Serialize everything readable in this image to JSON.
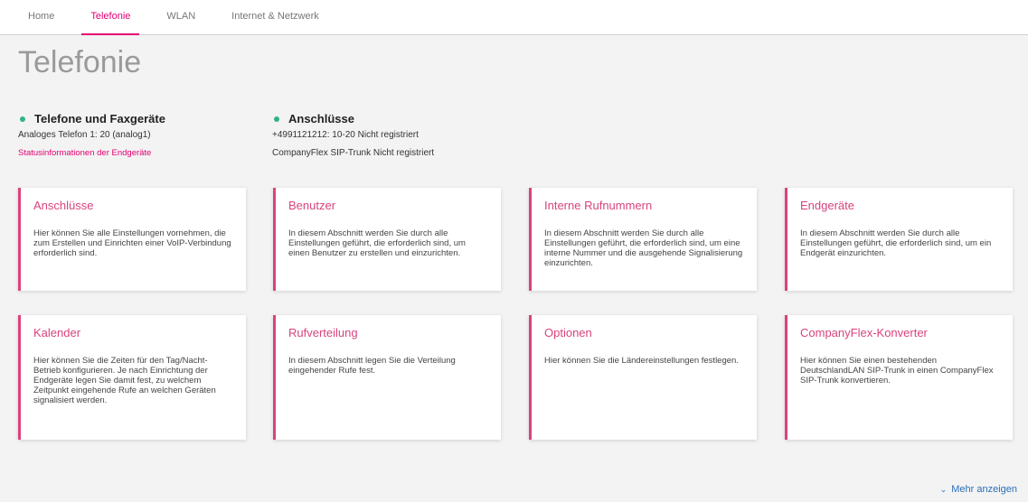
{
  "nav": {
    "tabs": [
      {
        "label": "Home"
      },
      {
        "label": "Telefonie"
      },
      {
        "label": "WLAN"
      },
      {
        "label": "Internet & Netzwerk"
      }
    ],
    "active": "Telefonie"
  },
  "page": {
    "title": "Telefonie"
  },
  "status": {
    "devices": {
      "heading": "Telefone und Faxgeräte",
      "line1": "Analoges Telefon 1: 20 (analog1)",
      "link": "Statusinformationen der Endgeräte",
      "dot_color": "#2fb380"
    },
    "connections": {
      "heading": "Anschlüsse",
      "line1": "+4991121212: 10-20 Nicht registriert",
      "line2": "CompanyFlex SIP-Trunk Nicht registriert",
      "dot_color": "#2fb380"
    }
  },
  "cards": [
    {
      "title": "Anschlüsse",
      "text": "Hier können Sie alle Einstellungen vornehmen, die zum Erstellen und Einrichten einer VoIP-Verbindung erforderlich sind."
    },
    {
      "title": "Benutzer",
      "text": "In diesem Abschnitt werden Sie durch alle Einstellungen geführt, die erforderlich sind, um einen Benutzer zu erstellen und einzurichten."
    },
    {
      "title": "Interne Rufnummern",
      "text": "In diesem Abschnitt werden Sie durch alle Einstellungen geführt, die erforderlich sind, um eine interne Nummer und die ausgehende Signalisierung einzurichten."
    },
    {
      "title": "Endgeräte",
      "text": "In diesem Abschnitt werden Sie durch alle Einstellungen geführt, die erforderlich sind, um ein Endgerät einzurichten."
    },
    {
      "title": "Kalender",
      "text": "Hier können Sie die Zeiten für den Tag/Nacht-Betrieb konfigurieren. Je nach Einrichtung der Endgeräte legen Sie damit fest, zu welchem Zeitpunkt eingehende Rufe an welchen Geräten signalisiert werden."
    },
    {
      "title": "Rufverteilung",
      "text": "In diesem Abschnitt legen Sie die Verteilung eingehender Rufe fest."
    },
    {
      "title": "Optionen",
      "text": "Hier können Sie die Ländereinstellungen festlegen."
    },
    {
      "title": "CompanyFlex-Konverter",
      "text": "Hier können Sie einen bestehenden DeutschlandLAN SIP-Trunk in einen CompanyFlex SIP-Trunk konvertieren."
    }
  ],
  "footer": {
    "more_label": "Mehr anzeigen",
    "more_icon": "chevron-down-icon"
  },
  "colors": {
    "accent": "#e20074",
    "card_border": "#d9437e",
    "status_ok": "#2fb380",
    "link_blue": "#2a6fb8"
  }
}
